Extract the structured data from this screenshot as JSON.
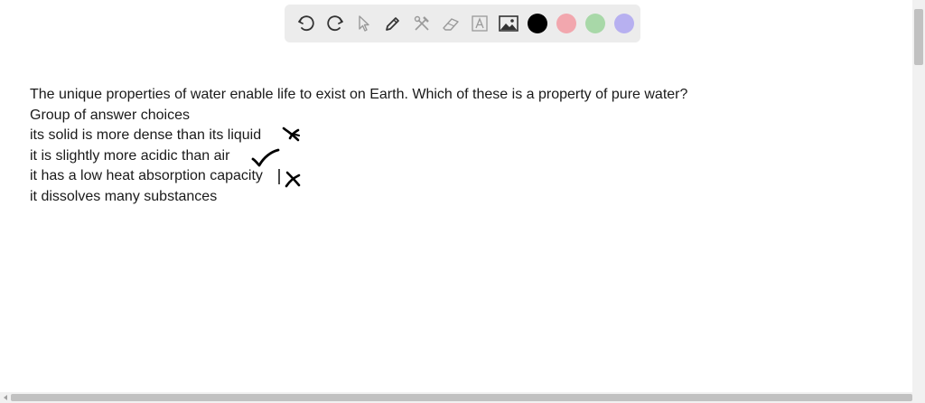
{
  "toolbar": {
    "tools": [
      {
        "icon": "undo-icon"
      },
      {
        "icon": "redo-icon"
      },
      {
        "icon": "pointer-icon"
      },
      {
        "icon": "pen-icon"
      },
      {
        "icon": "tools-icon"
      },
      {
        "icon": "eraser-icon"
      },
      {
        "icon": "text-icon"
      },
      {
        "icon": "image-icon"
      }
    ],
    "colors": [
      "#000000",
      "#f2a7ae",
      "#a8d8a8",
      "#b7b0f0"
    ]
  },
  "document": {
    "question": "The unique properties of water enable life to exist on Earth. Which of these is a property of pure water?",
    "subheading": "Group of answer choices",
    "choices": [
      "its solid is more dense than its liquid",
      "it is slightly more acidic than air",
      "it has a low heat absorption capacity",
      "it dissolves many substances"
    ]
  }
}
